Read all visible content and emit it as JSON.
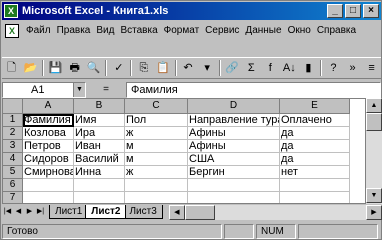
{
  "window": {
    "title": "Microsoft Excel - Книга1.xls",
    "app_icon": "excel-icon"
  },
  "title_buttons": [
    "_",
    "□",
    "×"
  ],
  "menu": {
    "items": [
      "Файл",
      "Правка",
      "Вид",
      "Вставка",
      "Формат",
      "Сервис",
      "Данные",
      "Окно",
      "Справка"
    ],
    "doc_buttons": [
      "_",
      "□",
      "×"
    ]
  },
  "toolbar": {
    "buttons": [
      "new-icon",
      "open-icon",
      "save-icon",
      "print-icon",
      "preview-icon",
      "spellcheck-icon",
      "copy-icon",
      "paste-icon",
      "undo-icon",
      "chevron-down-icon",
      "hyperlink-icon",
      "autosum-icon",
      "function-icon",
      "sort-ascending-icon",
      "chart-wizard-icon",
      "help-icon",
      "toolbar-options-icon",
      "align-icon"
    ],
    "glyphs": {
      "new-icon": "🗋",
      "open-icon": "📂",
      "save-icon": "💾",
      "print-icon": "🖶",
      "preview-icon": "🔍",
      "spellcheck-icon": "✓",
      "copy-icon": "⎘",
      "paste-icon": "📋",
      "undo-icon": "↶",
      "chevron-down-icon": "▾",
      "hyperlink-icon": "🔗",
      "autosum-icon": "Σ",
      "function-icon": "f",
      "sort-ascending-icon": "A↓",
      "chart-wizard-icon": "▮",
      "help-icon": "?",
      "toolbar-options-icon": "»",
      "align-icon": "≡"
    }
  },
  "formula_bar": {
    "name_box": "A1",
    "fx_label": "=",
    "content": "Фамилия"
  },
  "sheet": {
    "columns": [
      "A",
      "B",
      "C",
      "D",
      "E"
    ],
    "rows": [
      "1",
      "2",
      "3",
      "4",
      "5",
      "6",
      "7"
    ],
    "cells": [
      [
        "Фамилия",
        "Имя",
        "Пол",
        "Направление тура",
        "Оплачено"
      ],
      [
        "Козлова",
        "Ира",
        "ж",
        "Афины",
        "да"
      ],
      [
        "Петров",
        "Иван",
        "м",
        "Афины",
        "да"
      ],
      [
        "Сидоров",
        "Василий",
        "м",
        "США",
        "да"
      ],
      [
        "Смирнова",
        "Инна",
        "ж",
        "Бергин",
        "нет"
      ],
      [
        "",
        "",
        "",
        "",
        ""
      ],
      [
        "",
        "",
        "",
        "",
        ""
      ]
    ]
  },
  "sheet_tabs": [
    "Лист1",
    "Лист2",
    "Лист3"
  ],
  "active_tab": "Лист2",
  "status": {
    "ready": "Готово",
    "num": "NUM"
  }
}
